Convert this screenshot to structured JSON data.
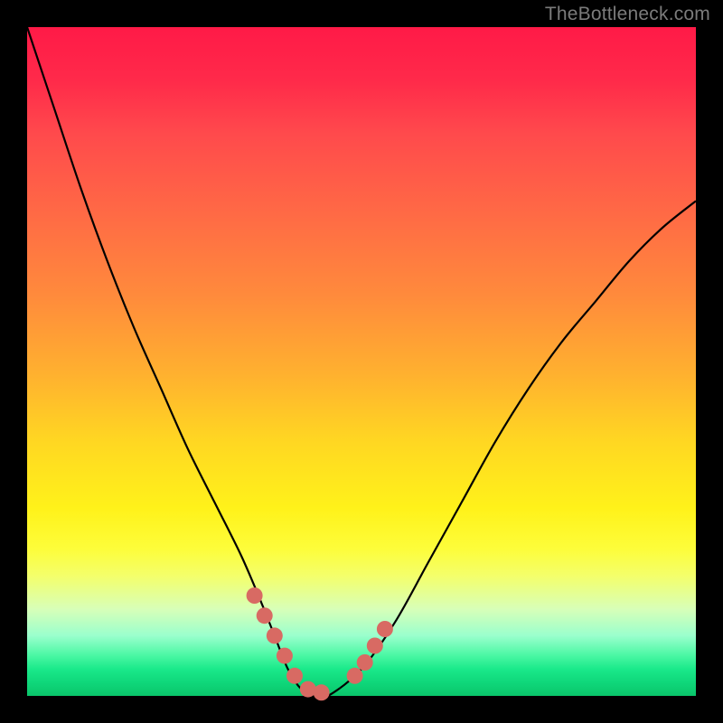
{
  "watermark": "TheBottleneck.com",
  "colors": {
    "background": "#000000",
    "curve": "#000000",
    "marker": "#d86a63"
  },
  "chart_data": {
    "type": "line",
    "title": "",
    "xlabel": "",
    "ylabel": "",
    "ylim": [
      0,
      100
    ],
    "x": [
      0,
      4,
      8,
      12,
      16,
      20,
      24,
      28,
      32,
      35,
      37,
      39,
      41,
      43,
      45,
      50,
      55,
      60,
      65,
      70,
      75,
      80,
      85,
      90,
      95,
      100
    ],
    "values": [
      100,
      88,
      76,
      65,
      55,
      46,
      37,
      29,
      21,
      14,
      9,
      4,
      1,
      0,
      0,
      4,
      11,
      20,
      29,
      38,
      46,
      53,
      59,
      65,
      70,
      74
    ],
    "markers": {
      "left_cluster_x": [
        34.0,
        35.5,
        37.0,
        38.5,
        40.0,
        42.0,
        44.0
      ],
      "left_cluster_y": [
        15.0,
        12.0,
        9.0,
        6.0,
        3.0,
        1.0,
        0.5
      ],
      "right_cluster_x": [
        49.0,
        50.5,
        52.0,
        53.5
      ],
      "right_cluster_y": [
        3.0,
        5.0,
        7.5,
        10.0
      ]
    }
  }
}
